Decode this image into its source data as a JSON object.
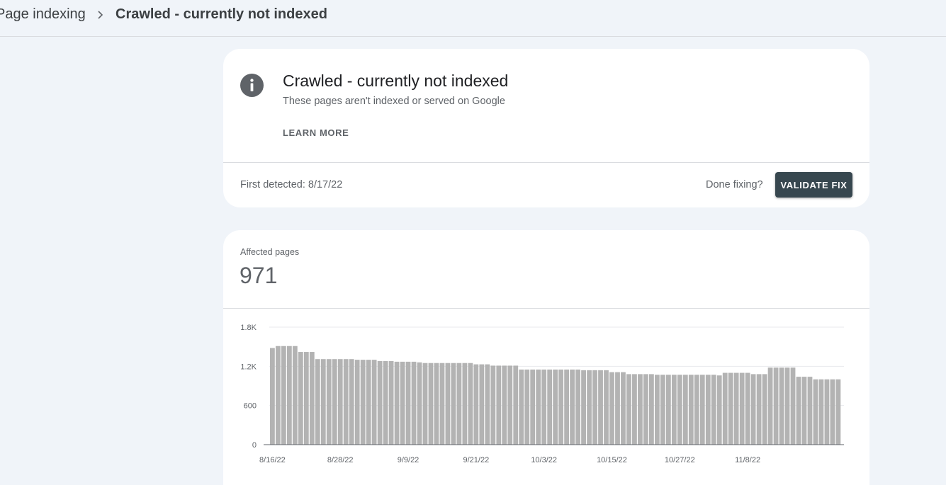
{
  "breadcrumb": {
    "parent": "Page indexing",
    "current": "Crawled - currently not indexed"
  },
  "issue": {
    "title": "Crawled - currently not indexed",
    "subtitle": "These pages aren't indexed or served on Google",
    "learn_more": "LEARN MORE",
    "first_detected": "First detected: 8/17/22",
    "done_fixing": "Done fixing?",
    "validate_label": "VALIDATE FIX",
    "icon": "info-icon"
  },
  "metric": {
    "label": "Affected pages",
    "value": "971"
  },
  "colors": {
    "bar": "#b3b3b3",
    "button": "#37474f",
    "background": "#f0f4f9"
  },
  "chart_data": {
    "type": "bar",
    "ylim": [
      0,
      1800
    ],
    "yticks": [
      {
        "value": 0,
        "label": "0"
      },
      {
        "value": 600,
        "label": "600"
      },
      {
        "value": 1200,
        "label": "1.2K"
      },
      {
        "value": 1800,
        "label": "1.8K"
      }
    ],
    "xticks": [
      {
        "index": 0,
        "label": "8/16/22"
      },
      {
        "index": 12,
        "label": "8/28/22"
      },
      {
        "index": 24,
        "label": "9/9/22"
      },
      {
        "index": 36,
        "label": "9/21/22"
      },
      {
        "index": 48,
        "label": "10/3/22"
      },
      {
        "index": 60,
        "label": "10/15/22"
      },
      {
        "index": 72,
        "label": "10/27/22"
      },
      {
        "index": 84,
        "label": "11/8/22"
      }
    ],
    "grid": true,
    "start_date": "8/16/22",
    "values": [
      1480,
      1510,
      1510,
      1510,
      1510,
      1420,
      1420,
      1420,
      1310,
      1310,
      1310,
      1310,
      1310,
      1310,
      1310,
      1300,
      1300,
      1300,
      1300,
      1280,
      1280,
      1280,
      1270,
      1270,
      1270,
      1270,
      1260,
      1250,
      1250,
      1250,
      1250,
      1250,
      1250,
      1250,
      1250,
      1250,
      1230,
      1230,
      1230,
      1210,
      1210,
      1210,
      1210,
      1210,
      1150,
      1150,
      1150,
      1150,
      1150,
      1150,
      1150,
      1150,
      1150,
      1150,
      1150,
      1140,
      1140,
      1140,
      1140,
      1140,
      1110,
      1110,
      1110,
      1080,
      1080,
      1080,
      1080,
      1080,
      1070,
      1070,
      1070,
      1070,
      1070,
      1070,
      1070,
      1070,
      1070,
      1070,
      1070,
      1060,
      1100,
      1100,
      1100,
      1100,
      1100,
      1080,
      1080,
      1080,
      1180,
      1180,
      1180,
      1180,
      1180,
      1040,
      1040,
      1040,
      1000,
      1000,
      1000,
      1000,
      1000
    ]
  }
}
